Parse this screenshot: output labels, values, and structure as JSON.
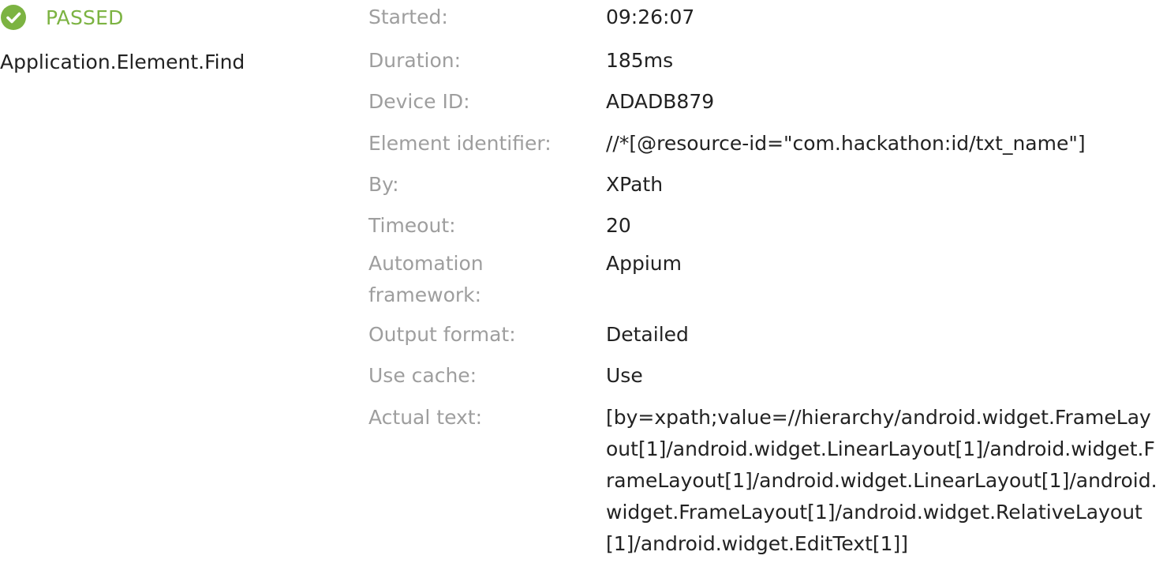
{
  "step": {
    "status": "PASSED",
    "status_color": "#7cb342",
    "status_icon": "check-circle-icon",
    "name": "Application.Element.Find"
  },
  "details": [
    {
      "label": "Started:",
      "value": "09:26:07"
    },
    {
      "label": "Duration:",
      "value": "185ms"
    },
    {
      "label": "Device ID:",
      "value": "ADADB879"
    },
    {
      "label": "Element identifier:",
      "value": "//*[@resource-id=\"com.hackathon:id/txt_name\"]"
    },
    {
      "label": "By:",
      "value": "XPath"
    },
    {
      "label": "Timeout:",
      "value": "20"
    },
    {
      "label": "Automation framework:",
      "value": "Appium"
    },
    {
      "label": "Output format:",
      "value": "Detailed"
    },
    {
      "label": "Use cache:",
      "value": "Use"
    },
    {
      "label": "Actual text:",
      "value": "[by=xpath;value=//hierarchy/android.widget.FrameLayout[1]/android.widget.LinearLayout[1]/android.widget.FrameLayout[1]/android.widget.LinearLayout[1]/android.widget.FrameLayout[1]/android.widget.RelativeLayout[1]/android.widget.EditText[1]]"
    }
  ]
}
